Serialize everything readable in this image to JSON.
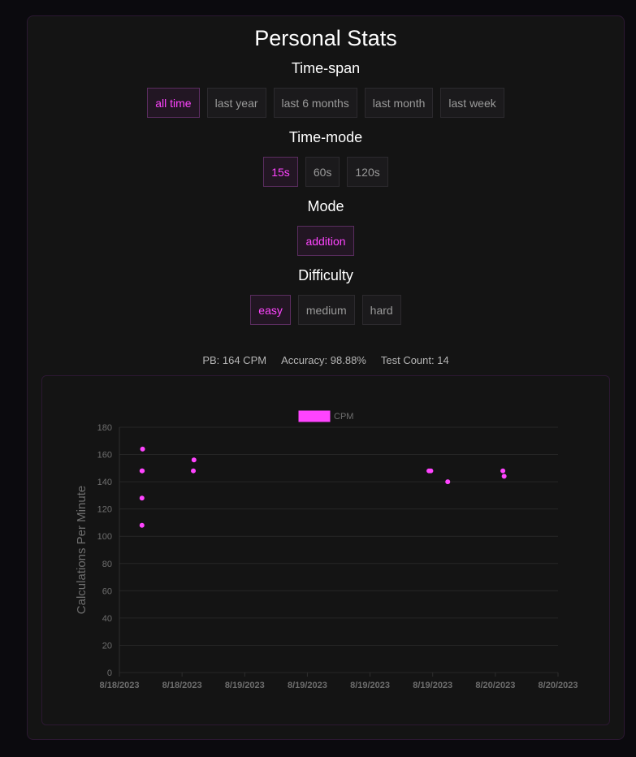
{
  "title": "Personal Stats",
  "timespan": {
    "label": "Time-span",
    "options": [
      "all time",
      "last year",
      "last 6 months",
      "last month",
      "last week"
    ],
    "active": 0
  },
  "timemode": {
    "label": "Time-mode",
    "options": [
      "15s",
      "60s",
      "120s"
    ],
    "active": 0
  },
  "mode": {
    "label": "Mode",
    "options": [
      "addition"
    ],
    "active": 0
  },
  "difficulty": {
    "label": "Difficulty",
    "options": [
      "easy",
      "medium",
      "hard"
    ],
    "active": 0
  },
  "stats": {
    "pb": "PB: 164 CPM",
    "accuracy": "Accuracy: 98.88%",
    "test_count": "Test Count: 14"
  },
  "colors": {
    "accent": "#ff44ff",
    "background": "#141414"
  },
  "chart_data": {
    "type": "scatter",
    "legend": [
      "CPM"
    ],
    "legend_position": "top",
    "ylabel": "Calculations Per Minute",
    "ylim": [
      0,
      180
    ],
    "yticks": [
      0,
      20,
      40,
      60,
      80,
      100,
      120,
      140,
      160,
      180
    ],
    "xticks": [
      "8/18/2023",
      "8/18/2023",
      "8/19/2023",
      "8/19/2023",
      "8/19/2023",
      "8/19/2023",
      "8/20/2023",
      "8/20/2023"
    ],
    "xlim_index": [
      0,
      7
    ],
    "grid": true,
    "series": [
      {
        "name": "CPM",
        "points": [
          {
            "x": 0.37,
            "y": 164
          },
          {
            "x": 0.36,
            "y": 148
          },
          {
            "x": 0.365,
            "y": 148
          },
          {
            "x": 0.36,
            "y": 128
          },
          {
            "x": 0.36,
            "y": 108
          },
          {
            "x": 1.19,
            "y": 156
          },
          {
            "x": 1.18,
            "y": 148
          },
          {
            "x": 4.94,
            "y": 148
          },
          {
            "x": 4.97,
            "y": 148
          },
          {
            "x": 5.24,
            "y": 140
          },
          {
            "x": 6.12,
            "y": 148
          },
          {
            "x": 6.14,
            "y": 144
          }
        ]
      }
    ]
  }
}
